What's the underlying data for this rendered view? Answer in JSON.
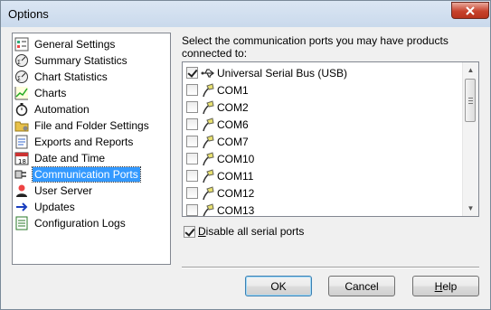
{
  "window": {
    "title": "Options"
  },
  "nav": {
    "items": [
      {
        "label": "General Settings",
        "icon": "checklist-icon"
      },
      {
        "label": "Summary Statistics",
        "icon": "stats-dial-icon"
      },
      {
        "label": "Chart Statistics",
        "icon": "stats-dial-icon"
      },
      {
        "label": "Charts",
        "icon": "line-chart-icon"
      },
      {
        "label": "Automation",
        "icon": "stopwatch-icon"
      },
      {
        "label": "File and Folder Settings",
        "icon": "folder-icon"
      },
      {
        "label": "Exports and Reports",
        "icon": "report-icon"
      },
      {
        "label": "Date and Time",
        "icon": "calendar-icon"
      },
      {
        "label": "Communication Ports",
        "icon": "plug-icon",
        "selected": true
      },
      {
        "label": "User Server",
        "icon": "user-server-icon"
      },
      {
        "label": "Updates",
        "icon": "arrow-right-icon"
      },
      {
        "label": "Configuration Logs",
        "icon": "log-icon"
      }
    ]
  },
  "ports": {
    "prompt": "Select the communication ports you may have products connected to:",
    "items": [
      {
        "label": "Universal Serial Bus (USB)",
        "checked": true,
        "icon": "usb-icon"
      },
      {
        "label": "COM1",
        "checked": false,
        "icon": "serial-cable-icon"
      },
      {
        "label": "COM2",
        "checked": false,
        "icon": "serial-cable-icon"
      },
      {
        "label": "COM6",
        "checked": false,
        "icon": "serial-cable-icon"
      },
      {
        "label": "COM7",
        "checked": false,
        "icon": "serial-cable-icon"
      },
      {
        "label": "COM10",
        "checked": false,
        "icon": "serial-cable-icon"
      },
      {
        "label": "COM11",
        "checked": false,
        "icon": "serial-cable-icon"
      },
      {
        "label": "COM12",
        "checked": false,
        "icon": "serial-cable-icon"
      },
      {
        "label": "COM13",
        "checked": false,
        "icon": "serial-cable-icon"
      }
    ]
  },
  "disable_serial": {
    "label_accel": "D",
    "label_rest": "isable all serial ports",
    "checked": true
  },
  "buttons": {
    "ok": "OK",
    "cancel": "Cancel",
    "help_accel": "H",
    "help_rest": "elp"
  },
  "colors": {
    "selection": "#3399ff",
    "close_button": "#c7432d"
  }
}
